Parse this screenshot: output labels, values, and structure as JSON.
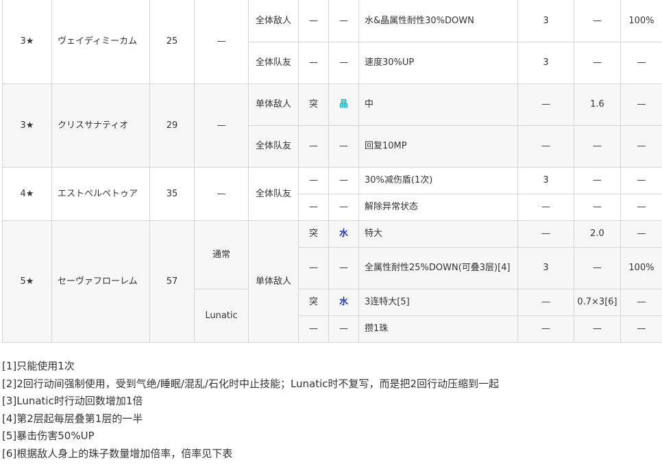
{
  "units": [
    {
      "rarity": "3★",
      "name": "ヴェイディミーカム",
      "cost": "25",
      "mode": "—",
      "skills": [
        {
          "target": "全体敌人",
          "attack": "—",
          "element": "—",
          "effect": "水&晶属性耐性30%DOWN",
          "turns": "3",
          "mult": "—",
          "rate": "100%"
        },
        {
          "target": "全体队友",
          "attack": "—",
          "element": "—",
          "effect": "速度30%UP",
          "turns": "3",
          "mult": "—",
          "rate": "—"
        }
      ]
    },
    {
      "rarity": "3★",
      "name": "クリスサナティオ",
      "cost": "29",
      "mode": "—",
      "skills": [
        {
          "target": "单体敌人",
          "attack": "突",
          "element": "晶",
          "effect": "中",
          "turns": "—",
          "mult": "1.6",
          "rate": "—"
        },
        {
          "target": "全体队友",
          "attack": "—",
          "element": "—",
          "effect": "回复10MP",
          "turns": "—",
          "mult": "—",
          "rate": "—"
        }
      ]
    },
    {
      "rarity": "4★",
      "name": "エストペルペトゥア",
      "cost": "35",
      "mode": "—",
      "target": "全体队友",
      "skills": [
        {
          "attack": "—",
          "element": "—",
          "effect": "30%减伤盾(1次)",
          "turns": "3",
          "mult": "—",
          "rate": "—"
        },
        {
          "attack": "—",
          "element": "—",
          "effect": "解除异常状态",
          "turns": "—",
          "mult": "—",
          "rate": "—"
        }
      ]
    },
    {
      "rarity": "5★",
      "name": "セーヴァフローレム",
      "cost": "57",
      "target": "单体敌人",
      "mode_normal": "通常",
      "mode_lunatic": "Lunatic",
      "skills": [
        {
          "attack": "突",
          "element": "水",
          "effect": "特大",
          "turns": "—",
          "mult": "2.0",
          "rate": "—"
        },
        {
          "attack": "—",
          "element": "—",
          "effect": "全属性耐性25%DOWN(可叠3层)[4]",
          "turns": "3",
          "mult": "—",
          "rate": "100%"
        },
        {
          "attack": "突",
          "element": "水",
          "effect": "3连特大[5]",
          "turns": "—",
          "mult": "0.7×3[6]",
          "rate": "—"
        },
        {
          "attack": "—",
          "element": "—",
          "effect": "攒1珠",
          "turns": "—",
          "mult": "—",
          "rate": "—"
        }
      ]
    }
  ],
  "notes": [
    "[1]只能使用1次",
    "[2]2回行动间强制使用，受到气绝/睡眠/混乱/石化时中止技能；Lunatic时不复写，而是把2回行动压缩到一起",
    "[3]Lunatic时行动回数增加1倍",
    "[4]第2层起每层叠第1层的一半",
    "[5]暴击伤害50%UP",
    "[6]根据敌人身上的珠子数量增加倍率，倍率见下表"
  ],
  "colors": {
    "crystal": "#1fb1c4",
    "water": "#1f2fb4",
    "alt_row": "#f7f7f7",
    "border": "#d4d4d4"
  }
}
